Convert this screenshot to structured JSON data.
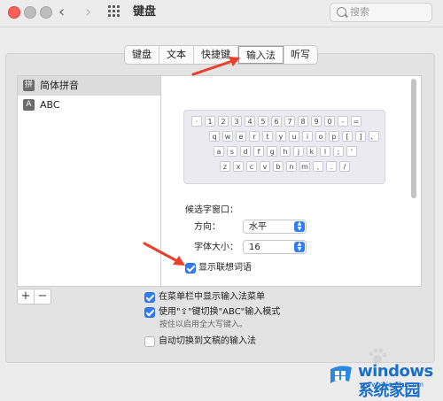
{
  "window": {
    "title": "键盘"
  },
  "search": {
    "placeholder": "搜索"
  },
  "tabs": [
    {
      "label": "键盘"
    },
    {
      "label": "文本"
    },
    {
      "label": "快捷键"
    },
    {
      "label": "输入法",
      "active": true
    },
    {
      "label": "听写"
    }
  ],
  "input_sources": [
    {
      "label": "简体拼音",
      "icon": "拼",
      "selected": true
    },
    {
      "label": "ABC",
      "icon": "A",
      "selected": false
    }
  ],
  "keyboard_rows": [
    [
      "·",
      "1",
      "2",
      "3",
      "4",
      "5",
      "6",
      "7",
      "8",
      "9",
      "0",
      "-",
      "="
    ],
    [
      "q",
      "w",
      "e",
      "r",
      "t",
      "y",
      "u",
      "i",
      "o",
      "p",
      "[",
      "]",
      "、"
    ],
    [
      "a",
      "s",
      "d",
      "f",
      "g",
      "h",
      "j",
      "k",
      "l",
      ";",
      "'"
    ],
    [
      "z",
      "x",
      "c",
      "v",
      "b",
      "n",
      "m",
      ",",
      ".",
      "/"
    ]
  ],
  "candidate_window": {
    "section_label": "候选字窗口：",
    "direction_label": "方向：",
    "direction_value": "水平",
    "font_size_label": "字体大小：",
    "font_size_value": "16"
  },
  "options": {
    "show_predictions": {
      "label": "显示联想词语",
      "checked": true
    },
    "show_in_menu_bar": {
      "label": "在菜单栏中显示输入法菜单",
      "checked": true
    },
    "caps_lock_switch": {
      "label": "使用\"⇪\"键切换\"ABC\"输入模式",
      "checked": true
    },
    "caps_lock_hint": "按住以启用全大写键入。",
    "auto_switch": {
      "label": "自动切换到文稿的输入法",
      "checked": false
    }
  },
  "list_controls": {
    "add": "+",
    "remove": "−"
  },
  "watermark": {
    "text": "windows系统家园",
    "sub": "www.ruinaitu.com"
  },
  "colors": {
    "accent": "#2f7cf6",
    "arrow": "#e8402c"
  }
}
